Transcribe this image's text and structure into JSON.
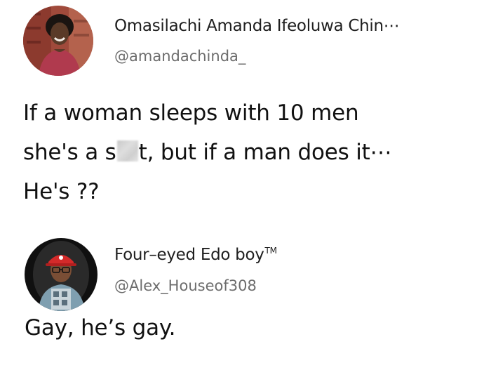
{
  "posts": [
    {
      "author": {
        "display_name": "Omasilachi Amanda Ifeoluwa Chin⋯",
        "handle": "@amandachinda_",
        "avatar_icon": "profile-photo-woman-smiling"
      },
      "body": {
        "line1": "If a woman sleeps with 10 men",
        "line2_before": "she's a s",
        "line2_censored": "censored-blur",
        "line2_after": "t, but if a man does it⋯",
        "line3": "He's ??"
      }
    },
    {
      "author": {
        "display_name": "Four–eyed Edo boy",
        "trademark": "TM",
        "handle": "@Alex_Houseof308",
        "avatar_icon": "profile-photo-man-red-cap-glasses"
      },
      "body": {
        "line1": "Gay, he’s gay."
      }
    }
  ],
  "colors": {
    "background": "#ffffff",
    "name_text": "#1f1f1f",
    "handle_text": "#6d6d6d",
    "body_text": "#111111"
  }
}
